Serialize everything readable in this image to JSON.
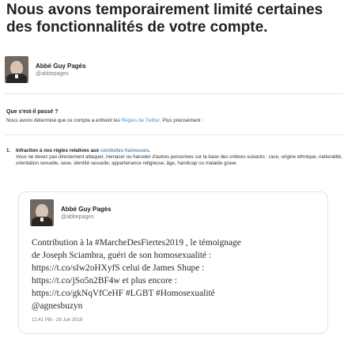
{
  "notice": {
    "headline": "Nous avons temporairement limité certaines des fonctionnalités de votre compte."
  },
  "account": {
    "display_name": "Abbé Guy Pagès",
    "handle": "@abbepages"
  },
  "what_happened": {
    "title": "Que s'est-il passé ?",
    "body_before": "Nous avons déterminé que ce compte a enfreint les ",
    "rules_link": "Règles de Twitter",
    "body_after": ". Plus précisément :"
  },
  "infraction": {
    "number": "1.",
    "title": "Infraction à nos règles relatives aux ",
    "link": "conduites haineuses",
    "title_end": ".",
    "text": "Vous ne devez pas directement attaquer, menacer ou harceler d'autres personnes sur la base des critères suivants : race, origine ethnique, nationalité, orientation sexuelle, sexe, identité sexuelle, appartenance religieuse, âge, handicap ou maladie grave."
  },
  "tweet": {
    "display_name": "Abbé Guy Pagès",
    "handle": "@abbepages",
    "lines": [
      "Contribution à la #MarcheDesFiertes2019 , le témoignage",
      "de Joseph Sciambra, guéri de son homosexualité :",
      "https://t.co/sIw2oHXyfS celui de James Shupe :",
      "https://t.co/jSo5n2BF4w et plus encore :",
      "https://t.co/gkNqVfCeHF #LGBT #Homosexualité",
      "@agnesbuzyn"
    ],
    "timestamp": "12:41 PM - 29 Jun 2019"
  },
  "colors": {
    "link": "#4a93cc",
    "divider": "#e1e6ea",
    "card_border": "#dfe4e8"
  }
}
